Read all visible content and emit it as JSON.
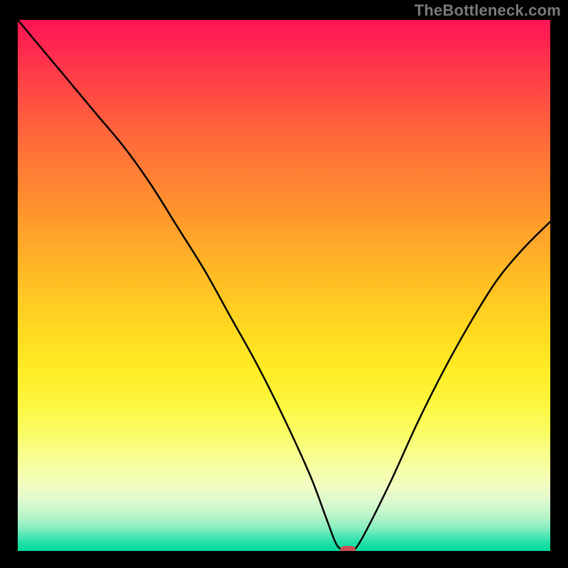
{
  "watermark": "TheBottleneck.com",
  "chart_data": {
    "type": "line",
    "title": "",
    "xlabel": "",
    "ylabel": "",
    "x_range": [
      0,
      100
    ],
    "y_range": [
      0,
      100
    ],
    "background_gradient": {
      "direction": "vertical",
      "stops": [
        {
          "pos": 0,
          "color": "#ff1455"
        },
        {
          "pos": 0.25,
          "color": "#ff7238"
        },
        {
          "pos": 0.5,
          "color": "#ffc522"
        },
        {
          "pos": 0.75,
          "color": "#fbfc6a"
        },
        {
          "pos": 0.95,
          "color": "#9af0c2"
        },
        {
          "pos": 1.0,
          "color": "#00db9e"
        }
      ]
    },
    "series": [
      {
        "name": "bottleneck-curve",
        "x": [
          0,
          5,
          10,
          15,
          20,
          25,
          30,
          35,
          40,
          45,
          50,
          55,
          58,
          60,
          62,
          63,
          65,
          70,
          75,
          80,
          85,
          90,
          95,
          100
        ],
        "values": [
          100,
          94,
          88,
          82,
          76,
          69,
          61,
          53,
          44,
          35,
          25,
          14,
          6,
          1,
          0,
          0,
          3,
          13,
          24,
          34,
          43,
          51,
          57,
          62
        ]
      }
    ],
    "marker": {
      "x": 62,
      "y": 0,
      "color": "#cc4e55",
      "shape": "rounded-rect"
    }
  }
}
